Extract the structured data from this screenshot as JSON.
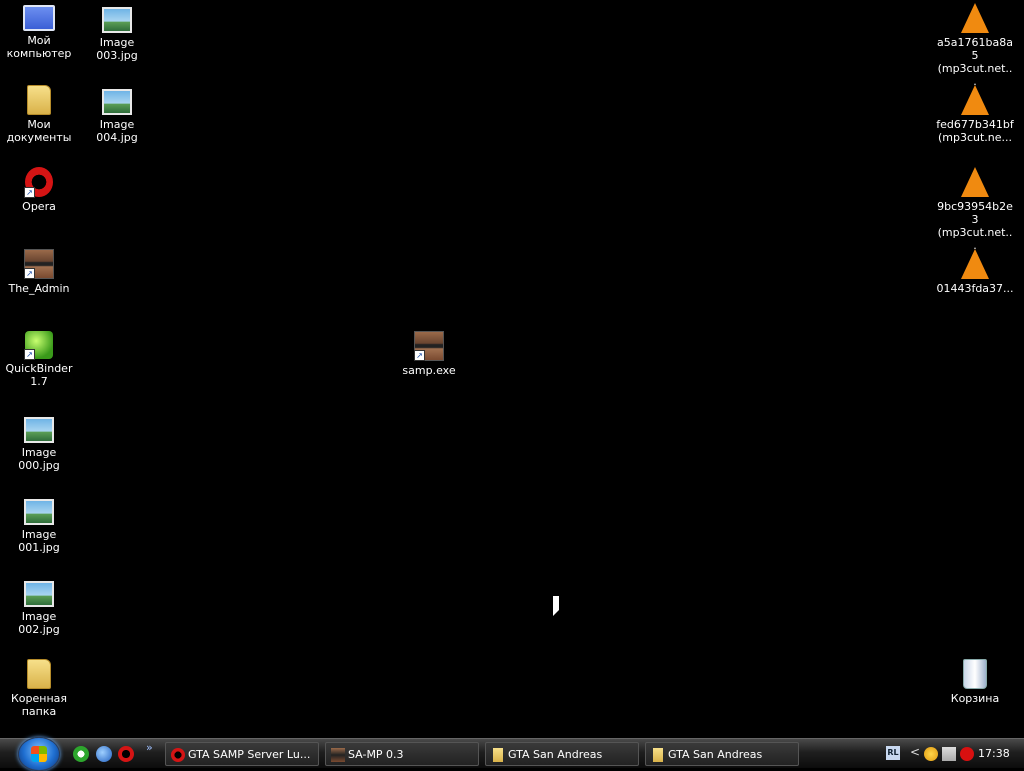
{
  "desktop": {
    "icons": {
      "my_computer": "Мой компьютер",
      "my_documents": "Мои документы",
      "opera": "Opera",
      "the_admin": "The_Admin",
      "quickbinder": "QuickBinder 1.7",
      "image000": "Image 000.jpg",
      "image001": "Image 001.jpg",
      "image002": "Image 002.jpg",
      "root_folder": "Коренная папка",
      "image003": "Image 003.jpg",
      "image004": "Image 004.jpg",
      "samp": "samp.exe",
      "vlc1": "a5a1761ba8a5 (mp3cut.net...",
      "vlc2": "fed677b341bf (mp3cut.ne...",
      "vlc3": "9bc93954b2e3 (mp3cut.net...",
      "vlc4": "01443fda37...",
      "recycle_bin": "Корзина"
    }
  },
  "taskbar": {
    "tasks": [
      {
        "label": "GTA SAMP Server Lu...",
        "icon": "opera-icon"
      },
      {
        "label": "SA-MP 0.3",
        "icon": "samp-icon"
      },
      {
        "label": "GTA San Andreas",
        "icon": "folder-icon"
      },
      {
        "label": "GTA San Andreas",
        "icon": "folder-icon"
      }
    ],
    "tray": {
      "lang": "RL",
      "chevron": "<",
      "clock": "17:38"
    },
    "quicklaunch_more": "»"
  },
  "colors": {
    "desktop_bg": "#000000",
    "vlc_orange": "#f08a10",
    "start_orb": "#1f6fd1"
  }
}
